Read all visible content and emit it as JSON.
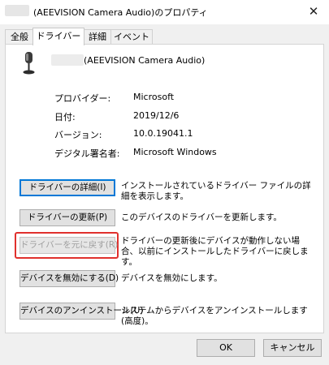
{
  "window": {
    "title": "(AEEVISION Camera Audio)のプロパティ",
    "close_icon": "close-icon"
  },
  "tabs": [
    {
      "label": "全般",
      "active": false
    },
    {
      "label": "ドライバー",
      "active": true
    },
    {
      "label": "詳細",
      "active": false
    },
    {
      "label": "イベント",
      "active": false
    }
  ],
  "device": {
    "name": "(AEEVISION Camera Audio)",
    "icon": "microphone-icon"
  },
  "properties": [
    {
      "label": "プロバイダー:",
      "value": "Microsoft"
    },
    {
      "label": "日付:",
      "value": "2019/12/6"
    },
    {
      "label": "バージョン:",
      "value": "10.0.19041.1"
    },
    {
      "label": "デジタル署名者:",
      "value": "Microsoft Windows"
    }
  ],
  "actions": [
    {
      "label": "ドライバーの詳細(I)",
      "description": "インストールされているドライバー ファイルの詳細を表示します。",
      "enabled": true,
      "focused": true
    },
    {
      "label": "ドライバーの更新(P)",
      "description": "このデバイスのドライバーを更新します。",
      "enabled": true
    },
    {
      "label": "ドライバーを元に戻す(R)",
      "description": "ドライバーの更新後にデバイスが動作しない場合、以前にインストールしたドライバーに戻します。",
      "enabled": false,
      "highlighted": true
    },
    {
      "label": "デバイスを無効にする(D)",
      "description": "デバイスを無効にします。",
      "enabled": true
    },
    {
      "label": "デバイスのアンインストール(U)",
      "description": "システムからデバイスをアンインストールします (高度)。",
      "enabled": true
    }
  ],
  "footer": {
    "ok_label": "OK",
    "cancel_label": "キャンセル"
  },
  "colors": {
    "highlight": "#e0302d",
    "focus": "#0078d7"
  }
}
